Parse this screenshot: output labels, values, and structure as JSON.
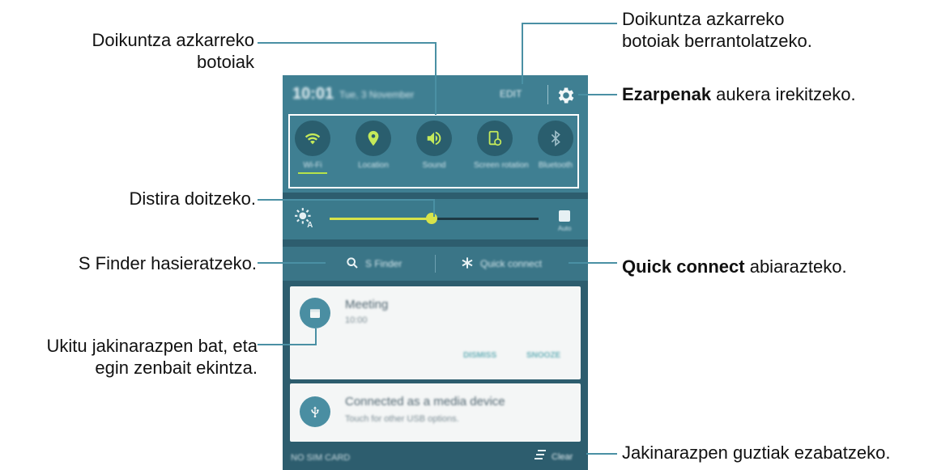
{
  "callouts": {
    "quick_buttons": "Doikuntza azkarreko\nbotoiak",
    "rearrange": "Doikuntza azkarreko\nbotoiak berrantolatzeko.",
    "settings_bold": "Ezarpenak",
    "settings_rest": " aukera irekitzeko.",
    "brightness": "Distira doitzeko.",
    "sfinder": "S Finder hasieratzeko.",
    "quick_connect_bold": "Quick connect",
    "quick_connect_rest": " abiarazteko.",
    "notification": "Ukitu jakinarazpen bat, eta\negin zenbait ekintza.",
    "clear_all": "Jakinarazpen guztiak ezabatzeko."
  },
  "panel": {
    "time": "10:01",
    "date": "Tue, 3 November",
    "edit": "EDIT",
    "toggles": [
      {
        "icon": "wifi-icon",
        "label": "Wi-Fi",
        "active": true
      },
      {
        "icon": "location-icon",
        "label": "Location",
        "active": true
      },
      {
        "icon": "sound-icon",
        "label": "Sound",
        "active": true
      },
      {
        "icon": "screen-rotation-icon",
        "label": "Screen rotation",
        "active": false
      },
      {
        "icon": "bluetooth-icon",
        "label": "Bluetooth",
        "active": false
      }
    ],
    "brightness_level": 0.49,
    "auto_label": "Auto",
    "sfinder_label": "S Finder",
    "quick_connect_label": "Quick connect",
    "notifications": [
      {
        "icon": "calendar-icon",
        "title": "Meeting",
        "subtitle": "10:00",
        "actions": [
          "DISMISS",
          "SNOOZE"
        ]
      },
      {
        "icon": "usb-icon",
        "title": "Connected as a media device",
        "subtitle": "Touch for other USB options."
      }
    ],
    "bottom_left": "NO SIM CARD",
    "clear_label": "Clear"
  },
  "colors": {
    "panel_bg": "#2d5d6e",
    "accent": "#4a90a4",
    "toggle_active": "#b5e24a",
    "slider": "#d7e34a"
  }
}
